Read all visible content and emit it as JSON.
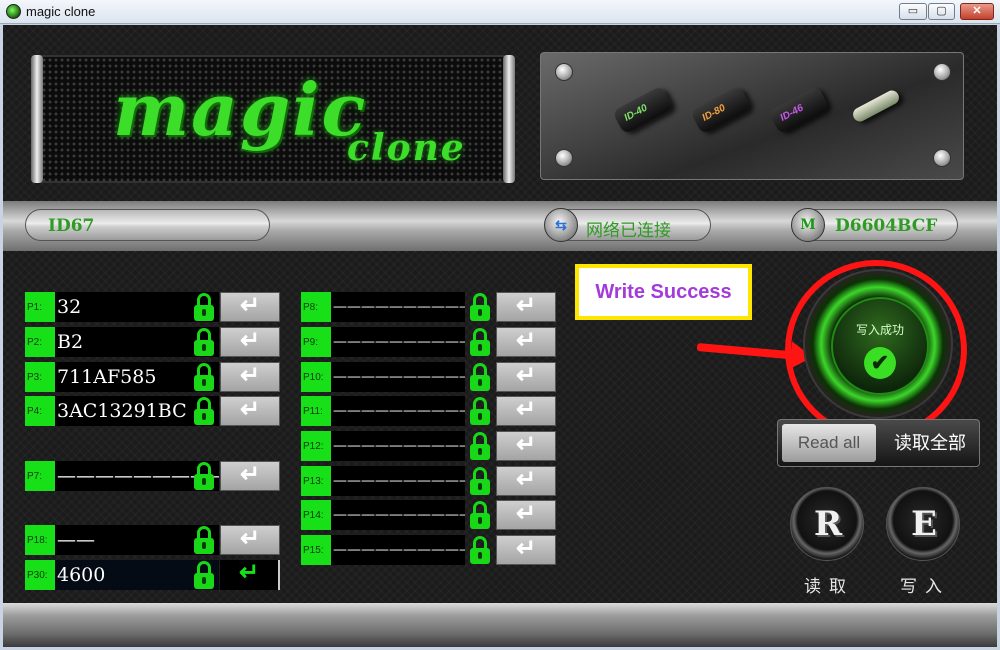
{
  "window": {
    "title": "magic clone",
    "buttons": {
      "minimize": "▭",
      "maximize": "▢",
      "close": "✕"
    }
  },
  "logo": {
    "main": "magic",
    "sub": "clone"
  },
  "chips": [
    {
      "label": "ID-40",
      "color": "#7fe06a"
    },
    {
      "label": "ID-80",
      "color": "#f3a23a"
    },
    {
      "label": "ID-46",
      "color": "#c65ae8"
    },
    {
      "label": "",
      "color": "#e8e8d8"
    }
  ],
  "status": {
    "chip_id": "ID67",
    "network": "网络已连接",
    "serial": "D6604BCF"
  },
  "pages_left": [
    {
      "label": "P1:",
      "value": "32"
    },
    {
      "label": "P2:",
      "value": "B2"
    },
    {
      "label": "P3:",
      "value": "711AF585"
    },
    {
      "label": "P4:",
      "value": "3AC13291BC"
    },
    {
      "label": "P7:",
      "value": "——————————"
    },
    {
      "label": "P18:",
      "value": "——"
    },
    {
      "label": "P30:",
      "value": "4600"
    }
  ],
  "pages_right": [
    {
      "label": "P8:",
      "value": "——————————"
    },
    {
      "label": "P9:",
      "value": "——————————"
    },
    {
      "label": "P10:",
      "value": "——————————"
    },
    {
      "label": "P11:",
      "value": "——————————"
    },
    {
      "label": "P12:",
      "value": "——————————"
    },
    {
      "label": "P13:",
      "value": "——————————"
    },
    {
      "label": "P14:",
      "value": "——————————"
    },
    {
      "label": "P15:",
      "value": "——————————"
    }
  ],
  "enter_glyph": "↵",
  "write_status": "Write Success",
  "big_button": {
    "label": "写入成功",
    "check": "✔"
  },
  "read_all": {
    "en": "Read all",
    "cn": "读取全部"
  },
  "read_button": {
    "letter": "R",
    "caption": "读取"
  },
  "write_button": {
    "letter": "E",
    "caption": "写入"
  },
  "colors": {
    "accent_green": "#18e018",
    "highlight_red": "#ff1414",
    "status_purple": "#a33ad9",
    "status_border": "#ffe600"
  }
}
